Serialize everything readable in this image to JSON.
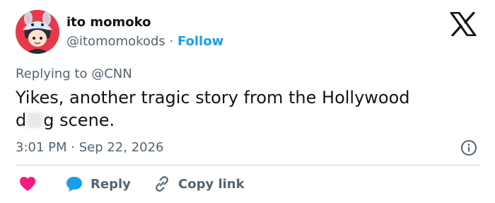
{
  "author": {
    "name": "ito momoko",
    "handle": "@itomomokods",
    "separator": " · ",
    "follow_label": "Follow"
  },
  "reply_to": {
    "prefix": "Replying to ",
    "mention": "@CNN"
  },
  "tweet": {
    "line1": "Yikes, another tragic story from the Hollywood",
    "line2_start": "d",
    "line2_end": "g scene."
  },
  "meta": {
    "timestamp": "3:01 PM · Sep 22, 2026"
  },
  "actions": {
    "reply_label": "Reply",
    "copy_link_label": "Copy link"
  },
  "icons": {
    "brand": "x-logo-icon",
    "info": "info-icon",
    "like": "heart-icon",
    "reply": "reply-bubble-icon",
    "copy": "link-icon"
  },
  "colors": {
    "accent": "#1d9bf0",
    "heart": "#f91880",
    "secondary_text": "#536471",
    "primary_text": "#0f1419",
    "avatar_bg": "#e8394a"
  }
}
